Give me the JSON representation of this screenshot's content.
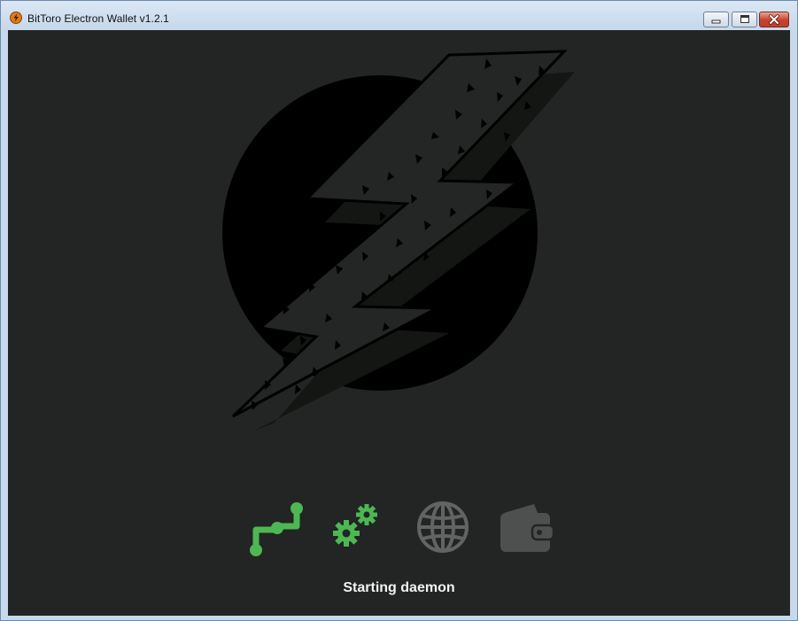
{
  "window": {
    "title": "BitToro Electron Wallet v1.2.1",
    "controls": [
      "minimize-icon",
      "maximize-icon",
      "close-icon"
    ]
  },
  "splash": {
    "logo": "lightning-bolt-logo",
    "steps": [
      {
        "icon": "network-path-icon",
        "state": "active",
        "color": "#4db853"
      },
      {
        "icon": "gears-icon",
        "state": "active",
        "color": "#4db853"
      },
      {
        "icon": "globe-icon",
        "state": "inactive",
        "color": "#626463"
      },
      {
        "icon": "wallet-icon",
        "state": "inactive",
        "color": "#4e4f4f"
      }
    ],
    "status_text": "Starting daemon"
  },
  "colors": {
    "background": "#222523",
    "active": "#4db853",
    "inactive": "#626463",
    "text": "#f2f2f2"
  }
}
